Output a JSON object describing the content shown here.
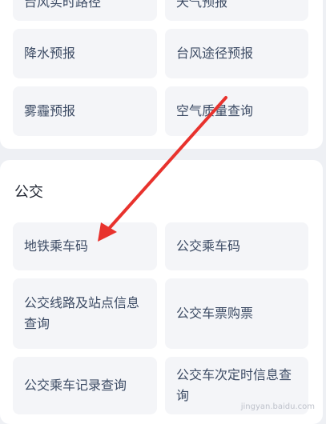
{
  "weather_section": {
    "tiles": [
      {
        "label": "台风实时路径"
      },
      {
        "label": "天气预报"
      },
      {
        "label": "降水预报"
      },
      {
        "label": "台风途径预报"
      },
      {
        "label": "雾霾预报"
      },
      {
        "label": "空气质量查询"
      }
    ]
  },
  "bus_section": {
    "title": "公交",
    "tiles": [
      {
        "label": "地铁乘车码"
      },
      {
        "label": "公交乘车码"
      },
      {
        "label": "公交线路及站点信息查询"
      },
      {
        "label": "公交车票购票"
      },
      {
        "label": "公交乘车记录查询"
      },
      {
        "label": "公交车次定时信息查询"
      }
    ]
  },
  "annotation": {
    "arrow_color": "#e8322d"
  },
  "watermark": {
    "text": "jingyan.baidu.com"
  }
}
